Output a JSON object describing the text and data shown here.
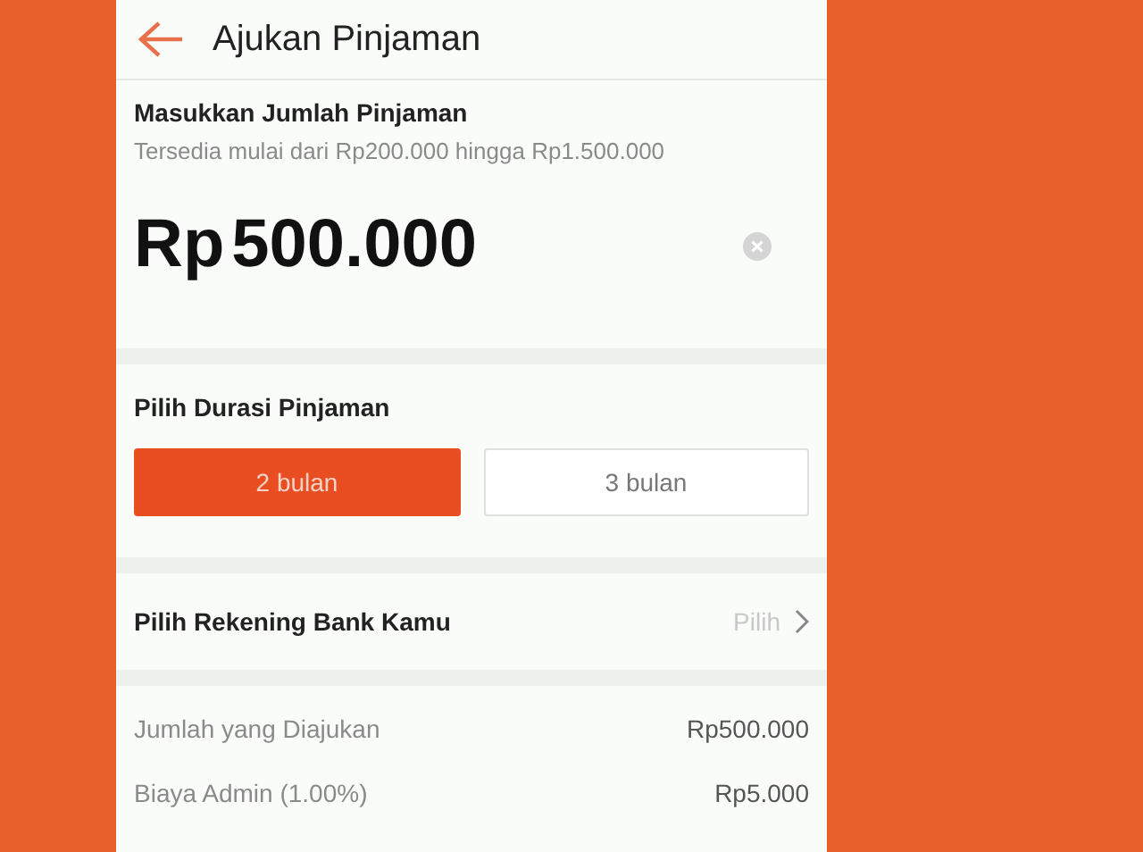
{
  "header": {
    "title": "Ajukan Pinjaman"
  },
  "amount": {
    "label": "Masukkan Jumlah Pinjaman",
    "hint": "Tersedia mulai dari Rp200.000 hingga Rp1.500.000",
    "currency": "Rp",
    "value": "500.000"
  },
  "duration": {
    "label": "Pilih Durasi Pinjaman",
    "options": [
      {
        "label": "2 bulan",
        "selected": true
      },
      {
        "label": "3 bulan",
        "selected": false
      }
    ]
  },
  "bank": {
    "label": "Pilih Rekening Bank Kamu",
    "action": "Pilih"
  },
  "summary": [
    {
      "label": "Jumlah yang Diajukan",
      "value": "Rp500.000"
    },
    {
      "label": "Biaya Admin (1.00%)",
      "value": "Rp5.000"
    }
  ]
}
